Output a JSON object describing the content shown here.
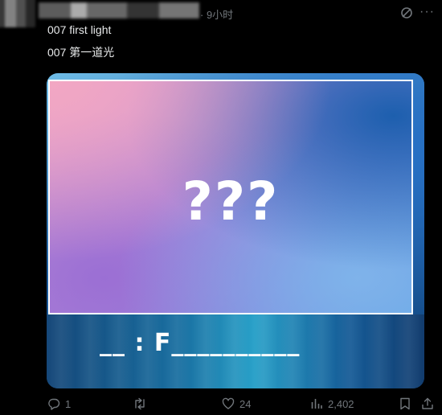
{
  "header": {
    "timestamp": "· 9小时"
  },
  "tweet": {
    "line1": "007 first light",
    "line2": "007 第一道光"
  },
  "media": {
    "puzzle_text": "???",
    "answer_template": "__ : F__________"
  },
  "actions": {
    "reply_count": "1",
    "retweet_count": "",
    "like_count": "24",
    "view_count": "2,402"
  },
  "colors": {
    "background": "#000000",
    "text": "#e7e9ea",
    "muted": "#71767b"
  },
  "icons": [
    "grok-icon",
    "more-icon",
    "reply-icon",
    "retweet-icon",
    "like-icon",
    "views-icon",
    "bookmark-icon",
    "share-icon"
  ]
}
